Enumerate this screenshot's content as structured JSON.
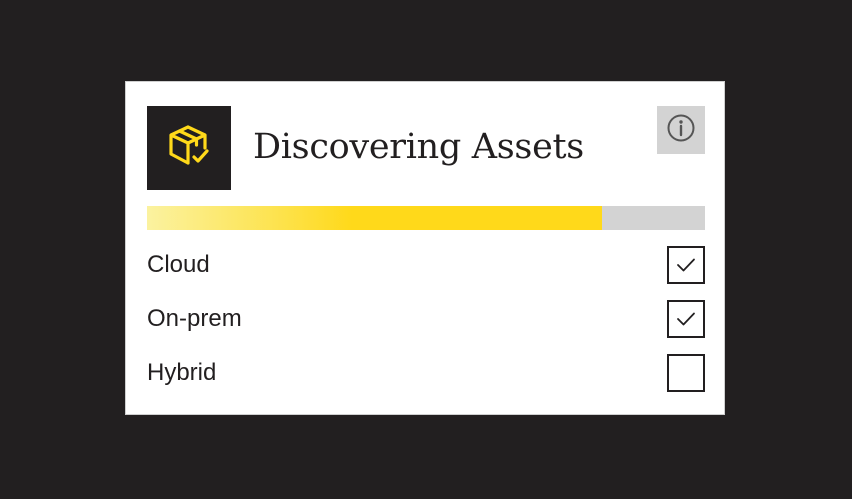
{
  "card": {
    "title": "Discovering Assets",
    "logo_icon": "package-check-icon",
    "info_icon": "info-icon",
    "progress": 0.815,
    "accent_color": "#ffd91a"
  },
  "options": [
    {
      "label": "Cloud",
      "checked": true
    },
    {
      "label": "On-prem",
      "checked": true
    },
    {
      "label": "Hybrid",
      "checked": false
    }
  ]
}
